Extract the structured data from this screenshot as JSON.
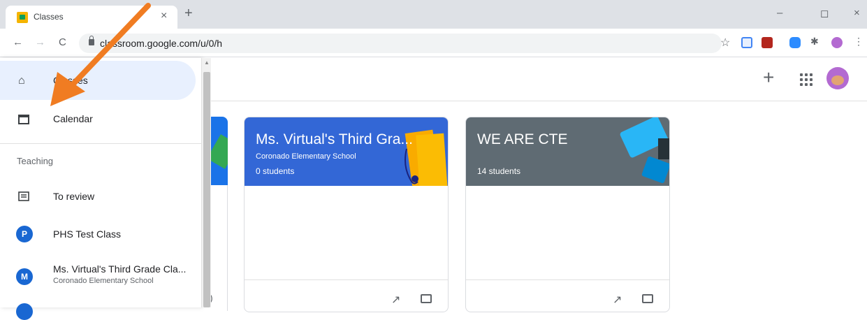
{
  "browser": {
    "tab_title": "Classes",
    "tab_close": "×",
    "new_tab": "+",
    "url": "classroom.google.com/u/0/h",
    "back": "←",
    "forward": "→",
    "reload": "C",
    "star": "☆",
    "menu": "⋮",
    "minimize": "–",
    "restore": "◻",
    "close": "×"
  },
  "header": {
    "create": "+"
  },
  "sidebar": {
    "items": [
      {
        "label": "Classes",
        "icon": "home-icon"
      },
      {
        "label": "Calendar",
        "icon": "calendar-icon"
      }
    ],
    "section": "Teaching",
    "teaching": [
      {
        "label": "To review",
        "icon": "inbox-icon"
      },
      {
        "label": "PHS Test Class",
        "letter": "P"
      },
      {
        "label": "Ms. Virtual's Third Grade Cla...",
        "sub": "Coronado Elementary School",
        "letter": "M"
      }
    ]
  },
  "cards": [
    {
      "title": "Ms. Virtual's Third Gra...",
      "subtitle": "Coronado Elementary School",
      "students": "0 students",
      "color": "#3367d6"
    },
    {
      "title": "WE ARE CTE",
      "subtitle": "",
      "students": "14 students",
      "color": "#5f6b73"
    }
  ],
  "peek_bracket": ")",
  "colors": {
    "accent": "#1967d2",
    "active_bg": "#e8f0fe",
    "arrow": "#f07c22"
  }
}
